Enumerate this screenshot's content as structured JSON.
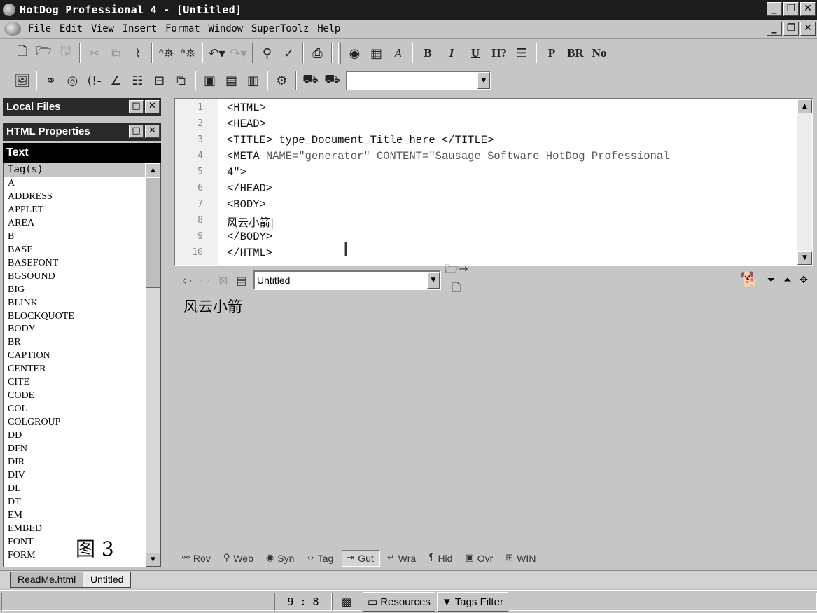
{
  "window": {
    "title": "HotDog Professional 4 - [Untitled]",
    "minimize": "_",
    "restore": "❐",
    "close": "✕"
  },
  "menu": {
    "items": [
      "File",
      "Edit",
      "View",
      "Insert",
      "Format",
      "Window",
      "SuperToolz",
      "Help"
    ]
  },
  "toolbar1": {
    "format_buttons": [
      "B",
      "I",
      "U",
      "H?",
      "P",
      "BR",
      "No"
    ]
  },
  "font_combo": {
    "value": ""
  },
  "panels": {
    "local_files": "Local Files",
    "html_properties": "HTML Properties",
    "text_header": "Text",
    "tags_column": "Tag(s)"
  },
  "tags": [
    "A",
    "ADDRESS",
    "APPLET",
    "AREA",
    "B",
    "BASE",
    "BASEFONT",
    "BGSOUND",
    "BIG",
    "BLINK",
    "BLOCKQUOTE",
    "BODY",
    "BR",
    "CAPTION",
    "CENTER",
    "CITE",
    "CODE",
    "COL",
    "COLGROUP",
    "DD",
    "DFN",
    "DIR",
    "DIV",
    "DL",
    "DT",
    "EM",
    "EMBED",
    "FONT",
    "FORM"
  ],
  "figure_label": "图 3",
  "editor": {
    "line_numbers": [
      "1",
      "2",
      "3",
      "4",
      "5",
      "6",
      "7",
      "8",
      "9",
      "10"
    ],
    "lines": {
      "l1": "<HTML>",
      "l2": "<HEAD>",
      "l3": "<TITLE> type_Document_Title_here </TITLE>",
      "l4a": "<META ",
      "l4b": "NAME=\"generator\" CONTENT=\"Sausage Software HotDog Professional",
      "l5": "4\">",
      "l6": "</HEAD>",
      "l7": "<BODY>",
      "l8": "风云小箭|",
      "l9": "</BODY>",
      "l10": "</HTML>"
    }
  },
  "preview": {
    "url": "Untitled",
    "body_text": "风云小箭"
  },
  "editor_status": {
    "items": [
      "Rov",
      "Web",
      "Syn",
      "Tag",
      "Gut",
      "Wra",
      "Hid",
      "Ovr",
      "WIN"
    ]
  },
  "doc_tabs": [
    "ReadMe.html",
    "Untitled"
  ],
  "statusbar": {
    "position": "9 : 8",
    "resources": "Resources",
    "tags_filter": "Tags Filter"
  }
}
